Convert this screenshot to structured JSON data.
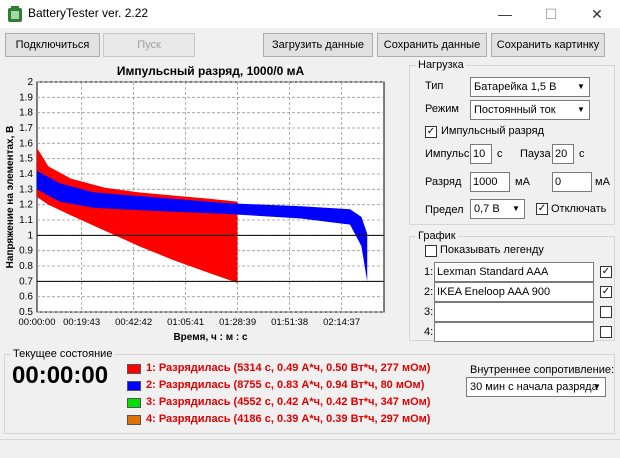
{
  "window": {
    "title": "BatteryTester ver. 2.22"
  },
  "toolbar": {
    "connect": "Подключиться",
    "start": "Пуск",
    "load": "Загрузить данные",
    "save": "Сохранить данные",
    "save_image": "Сохранить картинку"
  },
  "chart_data": {
    "type": "area",
    "title": "Импульсный разряд, 1000/0 мА",
    "xlabel": "Время, ч : м : с",
    "ylabel": "Напряжение на элементах, В",
    "ylim": [
      0.5,
      2
    ],
    "yticks": [
      "0.5",
      "0.6",
      "0.7",
      "0.8",
      "0.9",
      "1",
      "1.1",
      "1.2",
      "1.3",
      "1.4",
      "1.5",
      "1.6",
      "1.7",
      "1.8",
      "1.9",
      "2"
    ],
    "xticks": [
      "00:00:00",
      "00:19:43",
      "00:42:42",
      "01:05:41",
      "01:28:39",
      "01:51:38",
      "02:14:37"
    ],
    "xlim_seconds": [
      0,
      9200
    ],
    "reference_lines": [
      1.0,
      0.7
    ],
    "series": [
      {
        "color": "#ff0000",
        "upper": [
          [
            0,
            1.57
          ],
          [
            300,
            1.45
          ],
          [
            900,
            1.37
          ],
          [
            1800,
            1.31
          ],
          [
            2700,
            1.28
          ],
          [
            3600,
            1.26
          ],
          [
            4500,
            1.24
          ],
          [
            5314,
            1.22
          ]
        ],
        "lower": [
          [
            0,
            1.25
          ],
          [
            300,
            1.2
          ],
          [
            900,
            1.13
          ],
          [
            1800,
            1.03
          ],
          [
            2700,
            0.93
          ],
          [
            3600,
            0.84
          ],
          [
            4500,
            0.76
          ],
          [
            5314,
            0.69
          ]
        ]
      },
      {
        "color": "#0000ff",
        "upper": [
          [
            0,
            1.42
          ],
          [
            600,
            1.34
          ],
          [
            1500,
            1.28
          ],
          [
            3000,
            1.25
          ],
          [
            5000,
            1.21
          ],
          [
            7000,
            1.19
          ],
          [
            8300,
            1.17
          ],
          [
            8600,
            1.12
          ],
          [
            8755,
            1.01
          ]
        ],
        "lower": [
          [
            0,
            1.3
          ],
          [
            600,
            1.22
          ],
          [
            1500,
            1.18
          ],
          [
            3000,
            1.16
          ],
          [
            5000,
            1.14
          ],
          [
            7000,
            1.11
          ],
          [
            8300,
            1.07
          ],
          [
            8600,
            0.93
          ],
          [
            8755,
            0.7
          ]
        ]
      }
    ]
  },
  "load_panel": {
    "title": "Нагрузка",
    "type_label": "Тип",
    "type_value": "Батарейка 1,5 В",
    "mode_label": "Режим",
    "mode_value": "Постоянный ток",
    "pulse_label": "Импульсный разряд",
    "pulse_checked": "✓",
    "impulse_label": "Импульс",
    "impulse_value": "10",
    "impulse_unit": "с",
    "pause_label": "Пауза",
    "pause_value": "20",
    "pause_unit": "с",
    "discharge_label": "Разряд",
    "discharge_value": "1000",
    "discharge_unit": "мА",
    "discharge_value2": "0",
    "discharge_unit2": "мА",
    "limit_label": "Предел",
    "limit_value": "0,7 В",
    "disconnect_label": "Отключать",
    "disconnect_checked": "✓"
  },
  "graph_panel": {
    "title": "График",
    "legend_label": "Показывать легенду",
    "rows": [
      {
        "num": "1:",
        "value": "Lexman Standard AAA",
        "checked": "✓"
      },
      {
        "num": "2:",
        "value": "IKEA Eneloop AAA 900",
        "checked": "✓"
      },
      {
        "num": "3:",
        "value": "",
        "checked": ""
      },
      {
        "num": "4:",
        "value": "",
        "checked": ""
      }
    ]
  },
  "status": {
    "title": "Текущее состояние",
    "timer": "00:00:00",
    "items": [
      {
        "color": "#ff0000",
        "text": "1: Разрядилась (5314 с, 0.49 А*ч, 0.50 Вт*ч, 277 мОм)"
      },
      {
        "color": "#0000ff",
        "text": "2: Разрядилась (8755 с, 0.83 А*ч, 0.94 Вт*ч, 80 мОм)"
      },
      {
        "color": "#00e000",
        "text": "3: Разрядилась (4552 с, 0.42 А*ч, 0.42 Вт*ч, 347 мОм)"
      },
      {
        "color": "#e07000",
        "text": "4: Разрядилась (4186 с, 0.39 А*ч, 0.39 Вт*ч, 297 мОм)"
      }
    ],
    "resistance_label": "Внутреннее сопротивление:",
    "resistance_value": "30 мин с начала разряда"
  }
}
